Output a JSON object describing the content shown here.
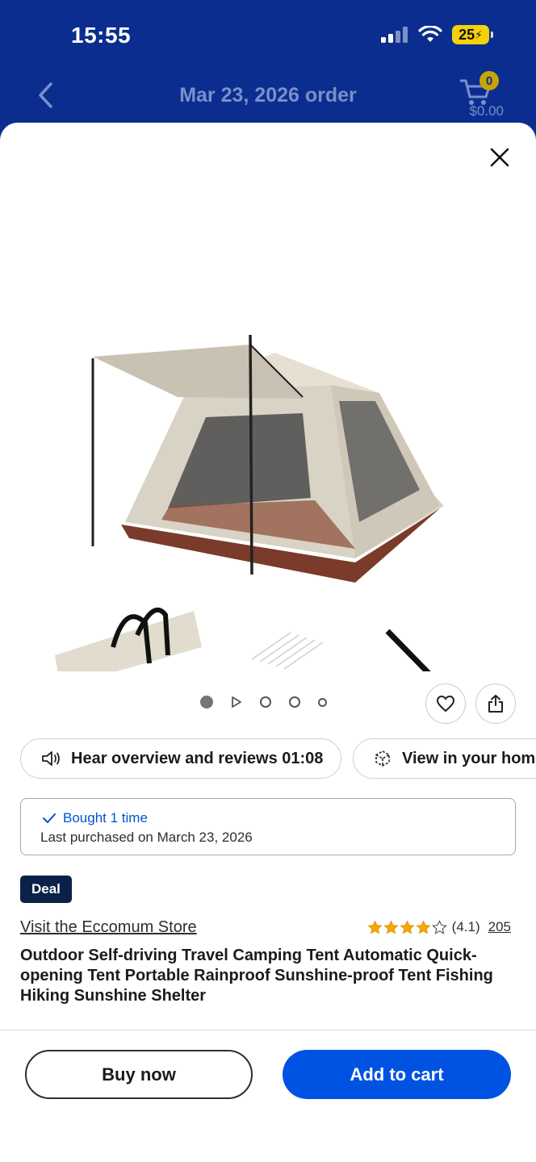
{
  "status_bar": {
    "time": "15:55",
    "battery": "25"
  },
  "header": {
    "title": "Mar 23, 2026 order",
    "cart_count": "0",
    "cart_total": "$0.00"
  },
  "actions": {
    "hear_overview": "Hear overview and reviews 01:08",
    "view_in_home": "View in your home"
  },
  "purchase_history": {
    "bought": "Bought 1 time",
    "last_purchased": "Last purchased on March 23, 2026"
  },
  "product": {
    "badge": "Deal",
    "store_link": "Visit the Eccomum Store",
    "rating": "(4.1)",
    "rating_value": 4.1,
    "review_count": "205",
    "title": "Outdoor Self-driving Travel Camping Tent Automatic Quick-opening Tent Portable Rainproof Sunshine-proof Tent Fishing Hiking Sunshine Shelter"
  },
  "buttons": {
    "buy_now": "Buy now",
    "add_to_cart": "Add to cart"
  },
  "colors": {
    "brand_blue": "#0a2d8f",
    "primary_button": "#0053e2",
    "star": "#f2a900",
    "deal_badge": "#0a2247"
  }
}
